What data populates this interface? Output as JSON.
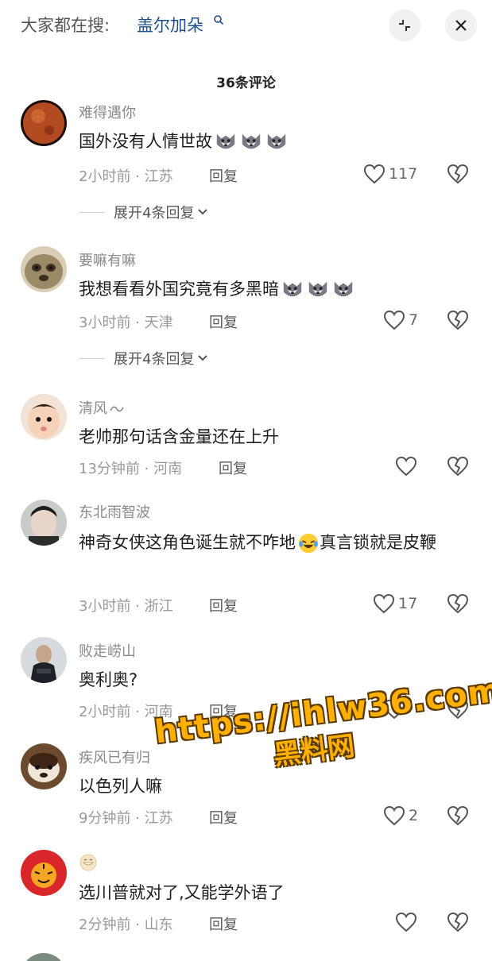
{
  "search": {
    "prefix": "大家都在搜:",
    "keyword": "盖尔加朵"
  },
  "comments_header": {
    "count_label": "36条评论"
  },
  "comments": [
    {
      "username": "难得遇你",
      "text": "国外没有人情世故",
      "emoji_count": 3,
      "time": "2小时前",
      "location": "江苏",
      "reply_label": "回复",
      "likes": "117",
      "expand_label": "展开4条回复"
    },
    {
      "username": "要嘛有嘛",
      "text": "我想看看外国究竟有多黑暗",
      "emoji_count": 3,
      "time": "3小时前",
      "location": "天津",
      "reply_label": "回复",
      "likes": "7",
      "expand_label": "展开4条回复"
    },
    {
      "username": "清风",
      "text": "老帅那句话含金量还在上升",
      "time": "13分钟前",
      "location": "河南",
      "reply_label": "回复",
      "likes": ""
    },
    {
      "username": "东北雨智波",
      "text_part1": "神奇女侠这角色诞生就不咋地",
      "text_part2": "真言锁就是皮鞭",
      "time": "3小时前",
      "location": "浙江",
      "reply_label": "回复",
      "likes": "17"
    },
    {
      "username": "败走崂山",
      "text": "奥利奥?",
      "time": "2小时前",
      "location": "河南",
      "reply_label": "回复",
      "likes": ""
    },
    {
      "username": "疾风已有归",
      "text": "以色列人嘛",
      "time": "9分钟前",
      "location": "江苏",
      "reply_label": "回复",
      "likes": "2"
    },
    {
      "username": "",
      "text": "选川普就对了,又能学外语了",
      "time": "2分钟前",
      "location": "山东",
      "reply_label": "回复",
      "likes": ""
    }
  ],
  "meta_separator": " · ",
  "watermark": {
    "line1": "https://ihlw36.com",
    "line2": "黑料网"
  },
  "colors": {
    "search_keyword": "#1f4f8c",
    "watermark_fill": "#ffb000"
  }
}
